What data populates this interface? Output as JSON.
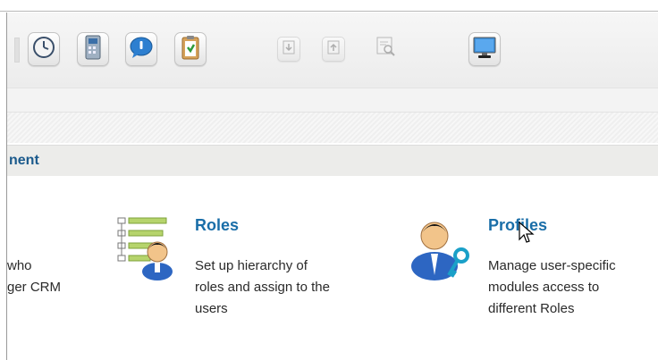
{
  "toolbar": {
    "buttons": [
      {
        "icon": "clock-icon"
      },
      {
        "icon": "calculator-icon"
      },
      {
        "icon": "chat-bubble-icon"
      },
      {
        "icon": "clipboard-icon"
      },
      {
        "icon": "import-icon"
      },
      {
        "icon": "export-icon"
      },
      {
        "icon": "find-duplicates-icon"
      },
      {
        "icon": "monitor-icon"
      }
    ]
  },
  "section": {
    "title": "nent"
  },
  "left_partial": {
    "text": "who\nger CRM"
  },
  "cards": [
    {
      "title": "Roles",
      "description": "Set up hierarchy of\nroles and assign to the\nusers",
      "icon": "roles-hierarchy-icon"
    },
    {
      "title": "Profiles",
      "description": "Manage user-specific\nmodules access to\ndifferent Roles",
      "icon": "user-key-icon"
    }
  ],
  "colors": {
    "link": "#1a6ea8",
    "section_title": "#1b5a8c"
  }
}
